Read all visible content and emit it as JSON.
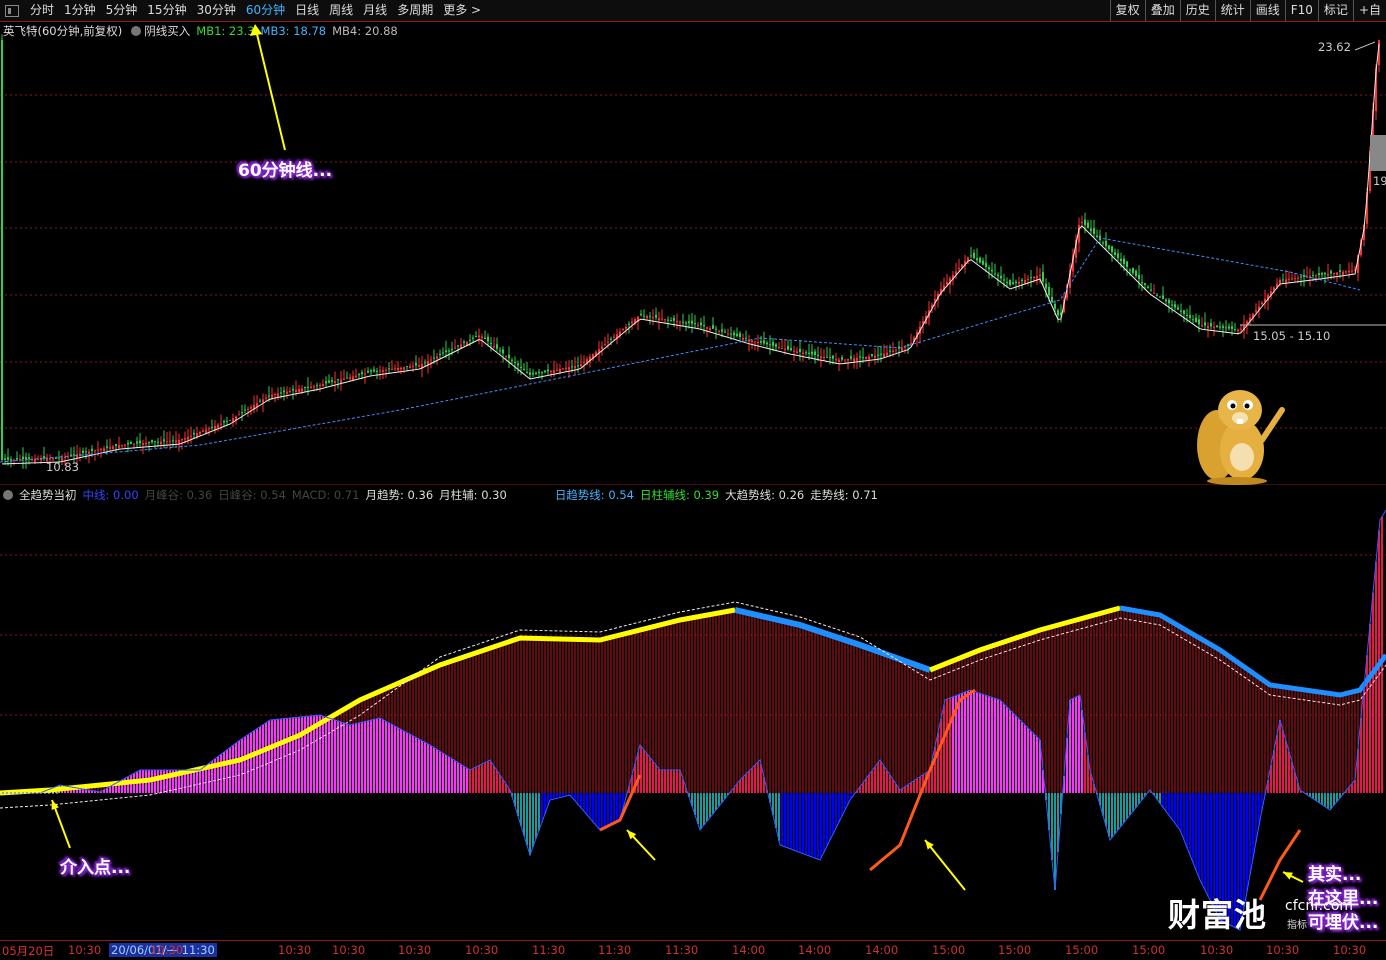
{
  "toolbar": {
    "periods": [
      "分时",
      "1分钟",
      "5分钟",
      "15分钟",
      "30分钟",
      "60分钟",
      "日线",
      "周线",
      "月线",
      "多周期",
      "更多 >"
    ],
    "active_period": "60分钟",
    "right_buttons": [
      "复权",
      "叠加",
      "历史",
      "统计",
      "画线",
      "F10",
      "标记",
      "+自"
    ]
  },
  "main_header": {
    "title": "英飞特(60分钟,前复权)",
    "indicator": "阴线买入",
    "mb1": "MB1: 23.3",
    "mb3": "MB3: 18.78",
    "mb4": "MB4: 20.88"
  },
  "price_labels": {
    "high": "23.62",
    "low": "10.83",
    "range": "15.05 - 15.10",
    "right_edge": "19"
  },
  "sub_header": {
    "name": "全趋势当初",
    "zhongxian": "中线: 0.00",
    "yuefenggu": "月峰谷: 0.36",
    "rifenggu": "日峰谷: 0.54",
    "macd": "MACD: 0.71",
    "yuequshi": "月趋势: 0.36",
    "yuezhufu": "月柱辅: 0.30",
    "riqushixian": "日趋势线: 0.54",
    "rizhufuxian": "日柱辅线: 0.39",
    "daqushixian": "大趋势线: 0.26",
    "zoushixian": "走势线: 0.71"
  },
  "callouts": {
    "c1": "60分钟线...",
    "c2": "介入点...",
    "c3a": "其实...",
    "c3b": "在这里...",
    "c3c": "可埋伏..."
  },
  "watermark": {
    "brand": "财富池",
    "site": "cfcnr.com",
    "tag": "指标"
  },
  "time_axis": {
    "date": "05月20日",
    "selected": "20/06/01/— 11:30",
    "ticks": [
      "10:30",
      "10:30",
      "10:30",
      "10:30",
      "10:30",
      "10:30",
      "11:30",
      "11:30",
      "11:30",
      "14:00",
      "14:00",
      "14:00",
      "15:00",
      "15:00",
      "15:00",
      "15:00",
      "10:30",
      "10:30",
      "10:30"
    ]
  },
  "colors": {
    "active": "#3fb4ff",
    "up": "#ff3030",
    "down": "#00d0d0",
    "yellow": "#ffff00",
    "magenta": "#ff33ff",
    "blue": "#0000ff",
    "teal": "#1a9a9a",
    "crimson": "#e8174a",
    "grid": "#8a1c1c"
  }
}
